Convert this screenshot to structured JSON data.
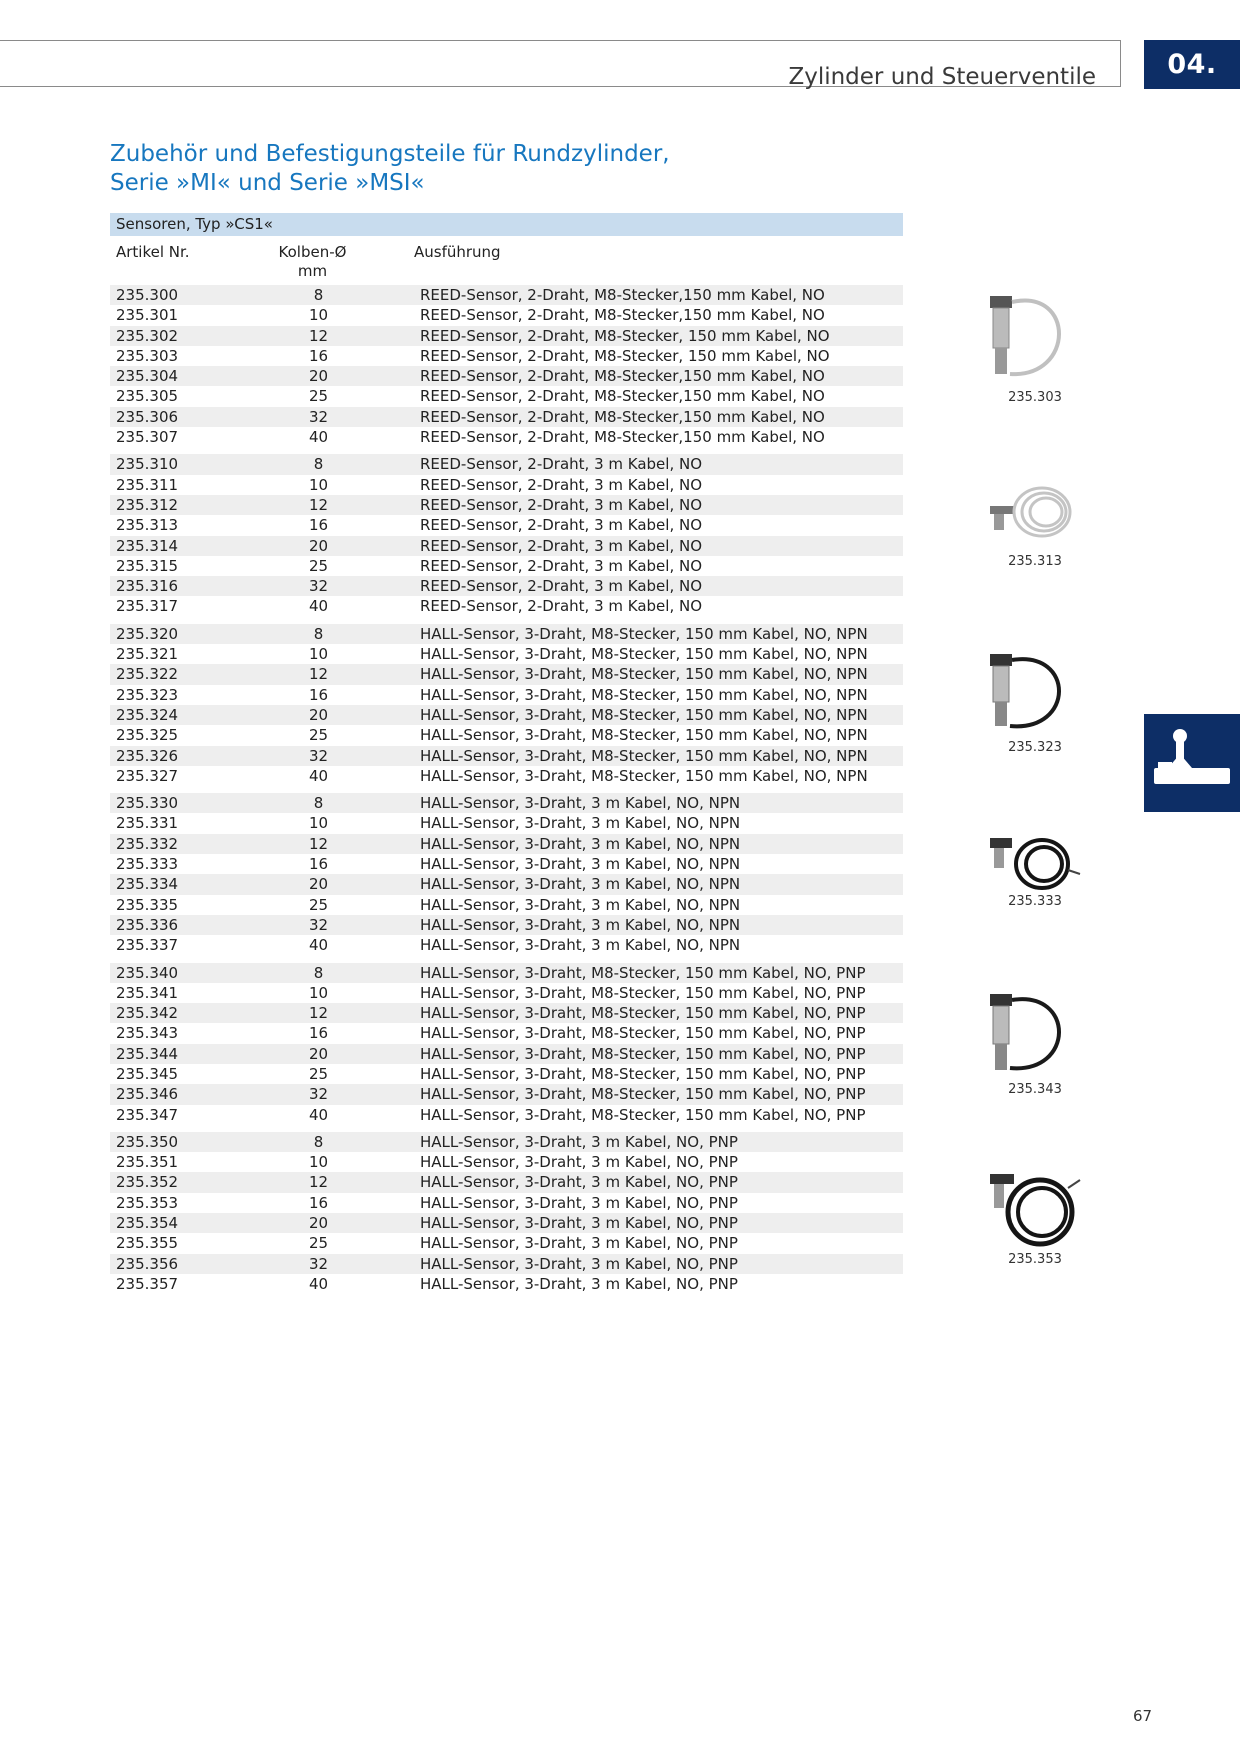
{
  "header": {
    "title": "Zylinder und Steuerventile",
    "chapter": "04."
  },
  "page_title": {
    "line1": "Zubehör und Befestigungsteile für Rundzylinder,",
    "line2": "Serie »MI« und Serie »MSI«"
  },
  "section": "Sensoren, Typ »CS1«",
  "columns": {
    "artikel": "Artikel Nr.",
    "kolben_line1": "Kolben-Ø",
    "kolben_line2": "mm",
    "ausfuehrung": "Ausführung"
  },
  "groups": [
    {
      "rows": [
        {
          "art": "235.300",
          "kol": "8",
          "aus": "REED-Sensor, 2-Draht, M8-Stecker,150 mm Kabel, NO"
        },
        {
          "art": "235.301",
          "kol": "10",
          "aus": "REED-Sensor, 2-Draht, M8-Stecker,150 mm Kabel, NO"
        },
        {
          "art": "235.302",
          "kol": "12",
          "aus": "REED-Sensor, 2-Draht, M8-Stecker, 150 mm Kabel, NO"
        },
        {
          "art": "235.303",
          "kol": "16",
          "aus": "REED-Sensor, 2-Draht, M8-Stecker, 150 mm Kabel, NO"
        },
        {
          "art": "235.304",
          "kol": "20",
          "aus": "REED-Sensor, 2-Draht, M8-Stecker,150 mm Kabel, NO"
        },
        {
          "art": "235.305",
          "kol": "25",
          "aus": "REED-Sensor, 2-Draht, M8-Stecker,150 mm Kabel, NO"
        },
        {
          "art": "235.306",
          "kol": "32",
          "aus": "REED-Sensor, 2-Draht, M8-Stecker,150 mm Kabel, NO"
        },
        {
          "art": "235.307",
          "kol": "40",
          "aus": "REED-Sensor, 2-Draht, M8-Stecker,150 mm Kabel, NO"
        }
      ]
    },
    {
      "rows": [
        {
          "art": "235.310",
          "kol": "8",
          "aus": "REED-Sensor, 2-Draht, 3 m Kabel, NO"
        },
        {
          "art": "235.311",
          "kol": "10",
          "aus": "REED-Sensor, 2-Draht, 3 m Kabel, NO"
        },
        {
          "art": "235.312",
          "kol": "12",
          "aus": "REED-Sensor, 2-Draht, 3 m Kabel, NO"
        },
        {
          "art": "235.313",
          "kol": "16",
          "aus": "REED-Sensor, 2-Draht, 3 m Kabel, NO"
        },
        {
          "art": "235.314",
          "kol": "20",
          "aus": "REED-Sensor, 2-Draht, 3 m Kabel, NO"
        },
        {
          "art": "235.315",
          "kol": "25",
          "aus": "REED-Sensor, 2-Draht, 3 m Kabel, NO"
        },
        {
          "art": "235.316",
          "kol": "32",
          "aus": "REED-Sensor, 2-Draht, 3 m Kabel, NO"
        },
        {
          "art": "235.317",
          "kol": "40",
          "aus": "REED-Sensor, 2-Draht, 3 m Kabel, NO"
        }
      ]
    },
    {
      "rows": [
        {
          "art": "235.320",
          "kol": "8",
          "aus": "HALL-Sensor, 3-Draht, M8-Stecker, 150 mm Kabel, NO, NPN"
        },
        {
          "art": "235.321",
          "kol": "10",
          "aus": "HALL-Sensor, 3-Draht, M8-Stecker, 150 mm Kabel, NO, NPN"
        },
        {
          "art": "235.322",
          "kol": "12",
          "aus": "HALL-Sensor, 3-Draht, M8-Stecker, 150 mm Kabel, NO, NPN"
        },
        {
          "art": "235.323",
          "kol": "16",
          "aus": "HALL-Sensor, 3-Draht, M8-Stecker, 150 mm Kabel, NO, NPN"
        },
        {
          "art": "235.324",
          "kol": "20",
          "aus": "HALL-Sensor, 3-Draht, M8-Stecker, 150 mm Kabel, NO, NPN"
        },
        {
          "art": "235.325",
          "kol": "25",
          "aus": "HALL-Sensor, 3-Draht, M8-Stecker, 150 mm Kabel, NO, NPN"
        },
        {
          "art": "235.326",
          "kol": "32",
          "aus": "HALL-Sensor, 3-Draht, M8-Stecker, 150 mm Kabel, NO, NPN"
        },
        {
          "art": "235.327",
          "kol": "40",
          "aus": "HALL-Sensor, 3-Draht, M8-Stecker, 150 mm Kabel, NO, NPN"
        }
      ]
    },
    {
      "rows": [
        {
          "art": "235.330",
          "kol": "8",
          "aus": "HALL-Sensor, 3-Draht, 3 m Kabel, NO, NPN"
        },
        {
          "art": "235.331",
          "kol": "10",
          "aus": "HALL-Sensor, 3-Draht, 3 m Kabel, NO, NPN"
        },
        {
          "art": "235.332",
          "kol": "12",
          "aus": "HALL-Sensor, 3-Draht, 3 m Kabel, NO, NPN"
        },
        {
          "art": "235.333",
          "kol": "16",
          "aus": "HALL-Sensor, 3-Draht, 3 m Kabel, NO, NPN"
        },
        {
          "art": "235.334",
          "kol": "20",
          "aus": "HALL-Sensor, 3-Draht, 3 m Kabel, NO, NPN"
        },
        {
          "art": "235.335",
          "kol": "25",
          "aus": "HALL-Sensor, 3-Draht, 3 m Kabel, NO, NPN"
        },
        {
          "art": "235.336",
          "kol": "32",
          "aus": "HALL-Sensor, 3-Draht, 3 m Kabel, NO, NPN"
        },
        {
          "art": "235.337",
          "kol": "40",
          "aus": "HALL-Sensor, 3-Draht, 3 m Kabel, NO, NPN"
        }
      ]
    },
    {
      "rows": [
        {
          "art": "235.340",
          "kol": "8",
          "aus": "HALL-Sensor, 3-Draht, M8-Stecker, 150 mm Kabel, NO, PNP"
        },
        {
          "art": "235.341",
          "kol": "10",
          "aus": "HALL-Sensor, 3-Draht, M8-Stecker, 150 mm Kabel, NO, PNP"
        },
        {
          "art": "235.342",
          "kol": "12",
          "aus": "HALL-Sensor, 3-Draht, M8-Stecker, 150 mm Kabel, NO, PNP"
        },
        {
          "art": "235.343",
          "kol": "16",
          "aus": "HALL-Sensor, 3-Draht, M8-Stecker, 150 mm Kabel, NO, PNP"
        },
        {
          "art": "235.344",
          "kol": "20",
          "aus": "HALL-Sensor, 3-Draht, M8-Stecker, 150 mm Kabel, NO, PNP"
        },
        {
          "art": "235.345",
          "kol": "25",
          "aus": "HALL-Sensor, 3-Draht, M8-Stecker, 150 mm Kabel, NO, PNP"
        },
        {
          "art": "235.346",
          "kol": "32",
          "aus": "HALL-Sensor, 3-Draht, M8-Stecker, 150 mm Kabel, NO, PNP"
        },
        {
          "art": "235.347",
          "kol": "40",
          "aus": "HALL-Sensor, 3-Draht, M8-Stecker, 150 mm Kabel, NO, PNP"
        }
      ]
    },
    {
      "rows": [
        {
          "art": "235.350",
          "kol": "8",
          "aus": "HALL-Sensor, 3-Draht, 3 m Kabel, NO, PNP"
        },
        {
          "art": "235.351",
          "kol": "10",
          "aus": "HALL-Sensor, 3-Draht, 3 m Kabel, NO, PNP"
        },
        {
          "art": "235.352",
          "kol": "12",
          "aus": "HALL-Sensor, 3-Draht, 3 m Kabel, NO, PNP"
        },
        {
          "art": "235.353",
          "kol": "16",
          "aus": "HALL-Sensor, 3-Draht, 3 m Kabel, NO, PNP"
        },
        {
          "art": "235.354",
          "kol": "20",
          "aus": "HALL-Sensor, 3-Draht, 3 m Kabel, NO, PNP"
        },
        {
          "art": "235.355",
          "kol": "25",
          "aus": "HALL-Sensor, 3-Draht, 3 m Kabel, NO, PNP"
        },
        {
          "art": "235.356",
          "kol": "32",
          "aus": "HALL-Sensor, 3-Draht, 3 m Kabel, NO, PNP"
        },
        {
          "art": "235.357",
          "kol": "40",
          "aus": "HALL-Sensor, 3-Draht, 3 m Kabel, NO, PNP"
        }
      ]
    }
  ],
  "photos": [
    {
      "caption": "235.303",
      "kind": "short-cable-connector",
      "color": "light-grey"
    },
    {
      "caption": "235.313",
      "kind": "coiled-cable",
      "color": "light-grey"
    },
    {
      "caption": "235.323",
      "kind": "short-cable-connector",
      "color": "black"
    },
    {
      "caption": "235.333",
      "kind": "coiled-cable",
      "color": "black"
    },
    {
      "caption": "235.343",
      "kind": "short-cable-connector",
      "color": "black"
    },
    {
      "caption": "235.353",
      "kind": "coiled-cable",
      "color": "black"
    }
  ],
  "page_number": "67",
  "colors": {
    "brand_blue": "#1777bf",
    "navy": "#0d2e66",
    "section_bar": "#c8dcee",
    "row_stripe": "#eeeeee"
  }
}
